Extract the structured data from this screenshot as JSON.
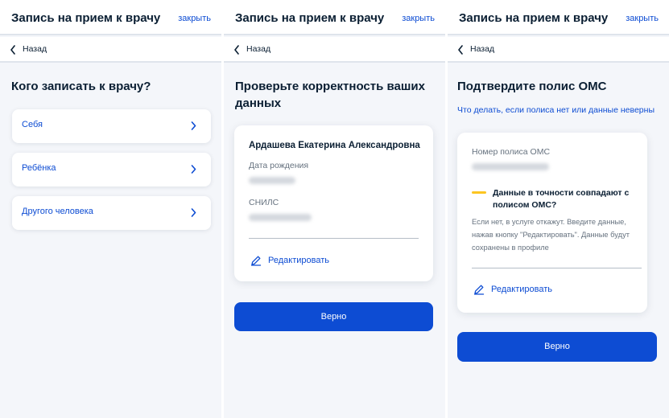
{
  "colors": {
    "accent": "#0d4cd3",
    "warning": "#fcc521",
    "background": "#f4f6fa",
    "text": "#0b1f33",
    "muted": "#66727f"
  },
  "header": {
    "title": "Запись на прием к врачу",
    "close_label": "закрыть"
  },
  "back_label": "Назад",
  "screen1": {
    "title": "Кого записать к врачу?",
    "options": [
      {
        "label": "Себя",
        "icon": "chevron-right-icon"
      },
      {
        "label": "Ребёнка",
        "icon": "chevron-right-icon"
      },
      {
        "label": "Другого человека",
        "icon": "chevron-right-icon"
      }
    ]
  },
  "screen2": {
    "title_line1": "Проверьте корректность ваших",
    "title_line2": "данных",
    "person_name": "Ардашева Екатерина Александровна",
    "birth_label": "Дата рождения",
    "snils_label": "СНИЛС",
    "edit_label": "Редактировать",
    "confirm_label": "Верно"
  },
  "screen3": {
    "title": "Подтвердите полис ОМС",
    "help_link": "Что делать, если полиса нет или данные неверны",
    "policy_label": "Номер полиса ОМС",
    "warning_title": "Данные в точности совпадают с полисом ОМС?",
    "warning_text": "Если нет, в услуге откажут. Введите данные, нажав кнопку \"Редактировать\". Данные будут сохранены в профиле",
    "edit_label": "Редактировать",
    "confirm_label": "Верно"
  }
}
